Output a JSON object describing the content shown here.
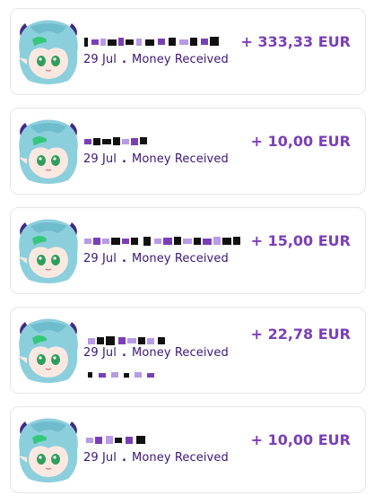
{
  "transactions": [
    {
      "date": "29 Jul",
      "type": "Money Received",
      "amount": "+ 333,33 EUR"
    },
    {
      "date": "29 Jul",
      "type": "Money Received",
      "amount": "+ 10,00 EUR"
    },
    {
      "date": "29 Jul",
      "type": "Money Received",
      "amount": "+ 15,00 EUR"
    },
    {
      "date": "29 Jul",
      "type": "Money Received",
      "amount": "+ 22,78 EUR"
    },
    {
      "date": "29 Jul",
      "type": "Money Received",
      "amount": "+ 10,00 EUR"
    }
  ],
  "separator": ".",
  "colors": {
    "amount": "#7a3fb8",
    "meta_text": "#3b1778",
    "card_border": "#e6e6ea",
    "redaction_dark": "#111111",
    "redaction_purple": "#7a3fb8",
    "redaction_lavender": "#b79be6"
  },
  "icons": {
    "avatar": "anime-avatar-icon",
    "redaction": "redaction-scribble"
  }
}
